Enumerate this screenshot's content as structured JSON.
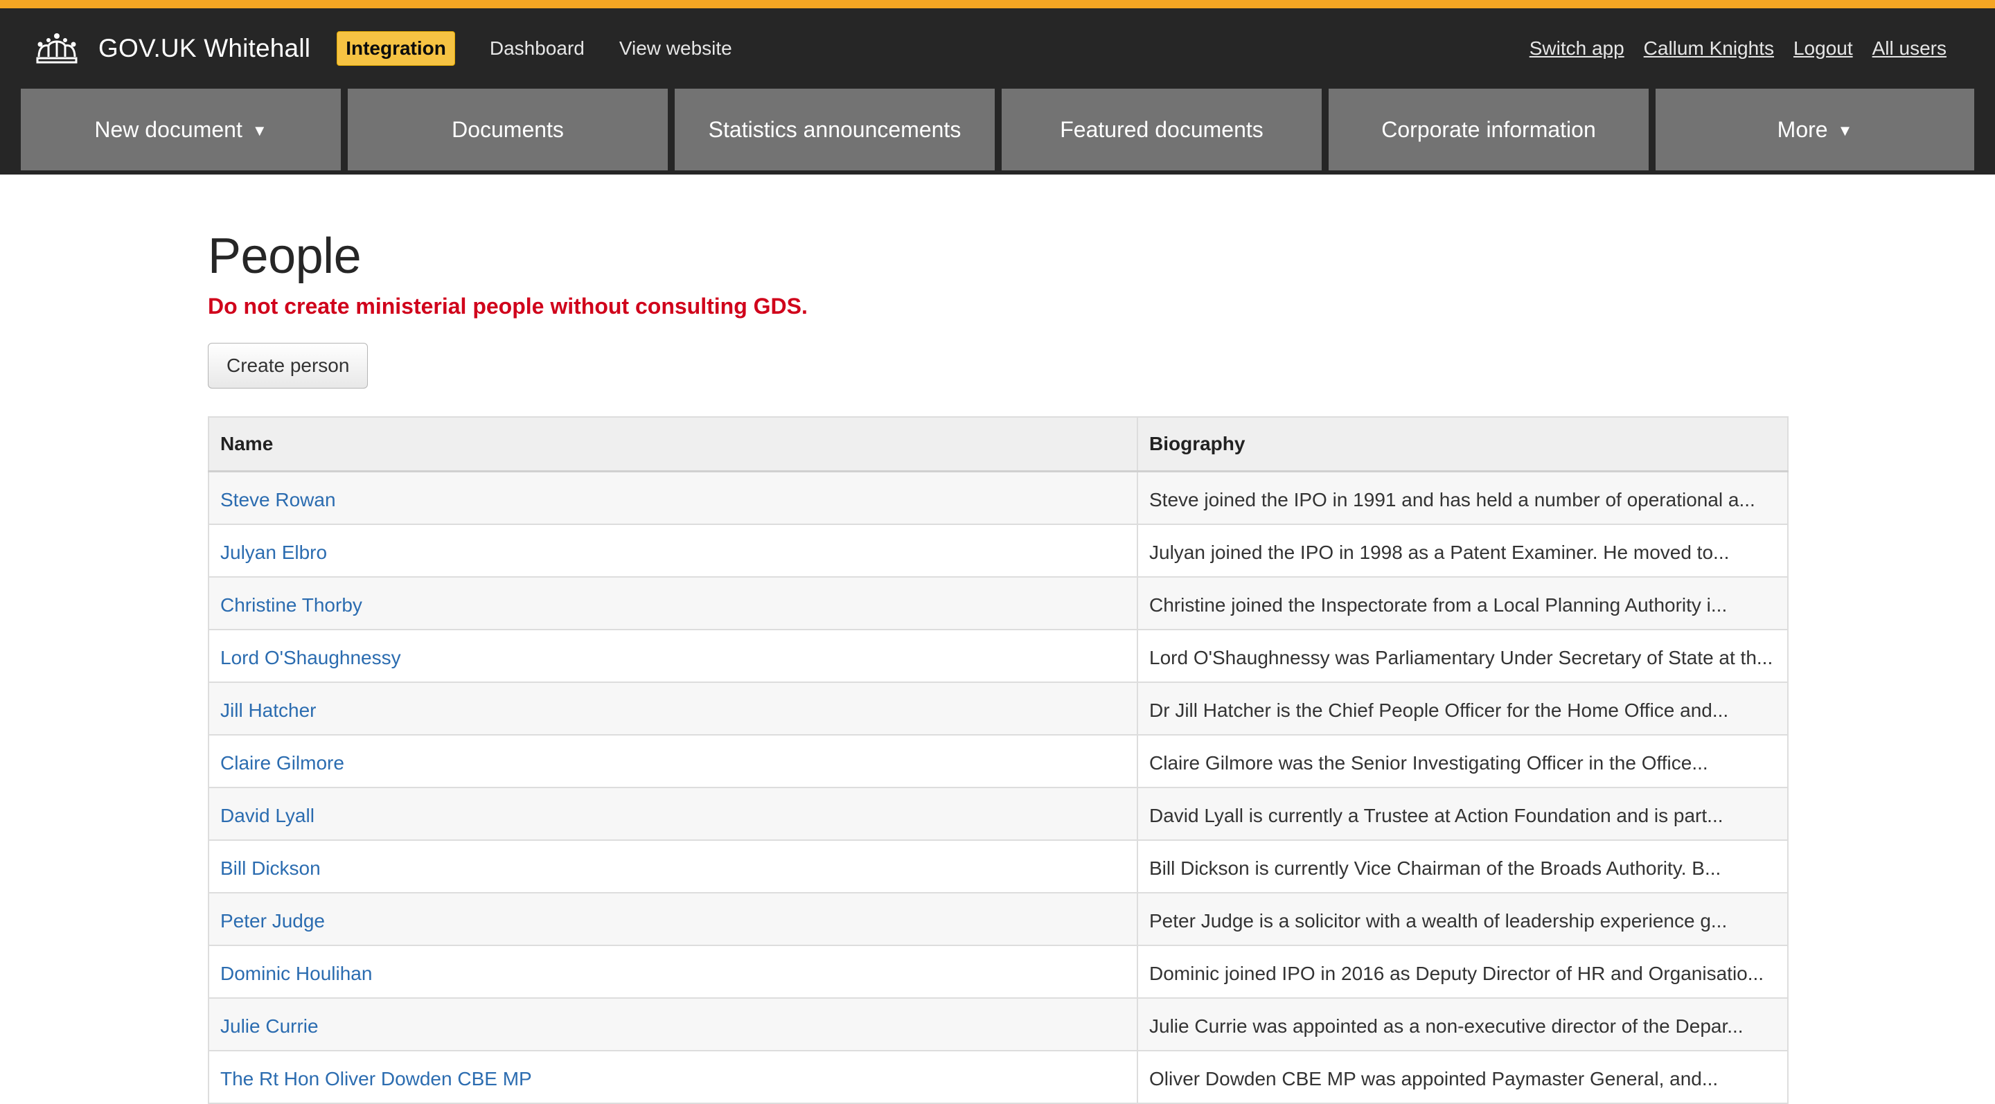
{
  "header": {
    "brand": "GOV.UK Whitehall",
    "environment": "Integration",
    "links": [
      "Dashboard",
      "View website"
    ],
    "user_links": [
      "Switch app",
      "Callum Knights",
      "Logout",
      "All users"
    ],
    "accent_color": "#f5a623"
  },
  "nav": {
    "tabs": [
      {
        "label": "New document",
        "dropdown": true
      },
      {
        "label": "Documents",
        "dropdown": false
      },
      {
        "label": "Statistics announcements",
        "dropdown": false
      },
      {
        "label": "Featured documents",
        "dropdown": false
      },
      {
        "label": "Corporate information",
        "dropdown": false
      },
      {
        "label": "More",
        "dropdown": true
      }
    ]
  },
  "page": {
    "title": "People",
    "warning": "Do not create ministerial people without consulting GDS.",
    "create_button": "Create person"
  },
  "table": {
    "columns": [
      "Name",
      "Biography"
    ],
    "rows": [
      {
        "name": "Steve Rowan",
        "bio": "Steve joined the IPO in 1991 and has held a number of operational a..."
      },
      {
        "name": "Julyan Elbro",
        "bio": "Julyan joined the IPO in 1998 as a Patent Examiner. He moved to..."
      },
      {
        "name": "Christine Thorby",
        "bio": "Christine joined the Inspectorate from a Local Planning Authority i..."
      },
      {
        "name": "Lord O'Shaughnessy",
        "bio": "Lord O'Shaughnessy was Parliamentary Under Secretary of State at th..."
      },
      {
        "name": "Jill Hatcher",
        "bio": "Dr Jill Hatcher is the Chief People Officer for the Home Office and..."
      },
      {
        "name": "Claire Gilmore",
        "bio": "Claire Gilmore was the Senior Investigating Officer in the Office..."
      },
      {
        "name": "David Lyall",
        "bio": "David Lyall is currently a Trustee at Action Foundation and is part..."
      },
      {
        "name": "Bill Dickson",
        "bio": "Bill Dickson is currently Vice Chairman of the Broads Authority. B..."
      },
      {
        "name": "Peter Judge",
        "bio": "Peter Judge is a solicitor with a wealth of leadership experience g..."
      },
      {
        "name": "Dominic Houlihan",
        "bio": "Dominic joined IPO in 2016 as Deputy Director of HR and Organisatio..."
      },
      {
        "name": "Julie Currie",
        "bio": "Julie Currie was appointed as a non-executive director of the Depar..."
      },
      {
        "name": "The Rt Hon Oliver Dowden CBE MP",
        "bio": "Oliver Dowden CBE MP was appointed Paymaster General, and..."
      }
    ]
  }
}
